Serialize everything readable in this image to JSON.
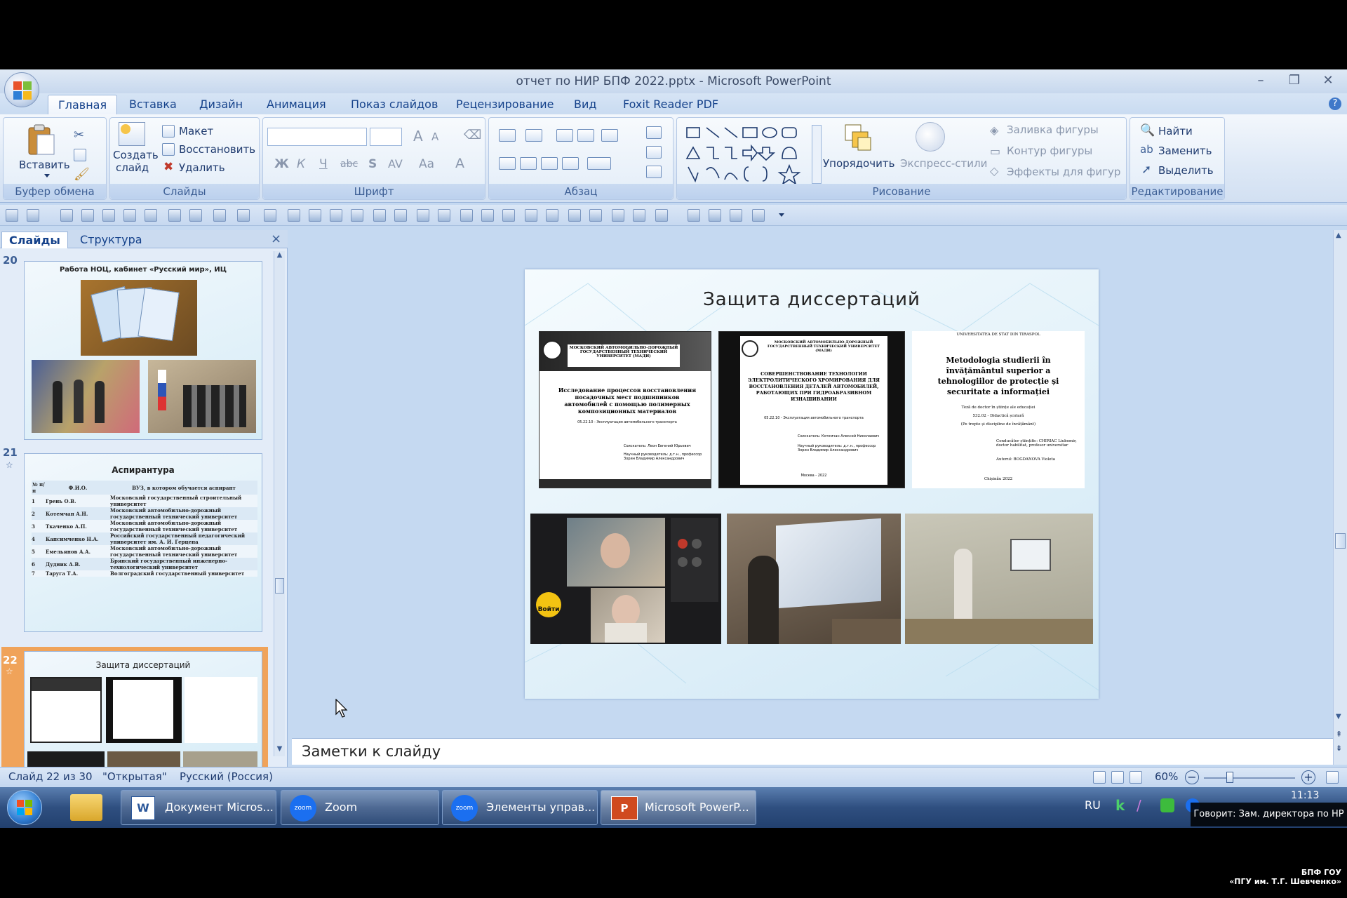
{
  "window": {
    "title": "отчет по НИР БПФ 2022.pptx - Microsoft PowerPoint",
    "minimize": "–",
    "restore": "❐",
    "close": "✕"
  },
  "tabs": [
    "Главная",
    "Вставка",
    "Дизайн",
    "Анимация",
    "Показ слайдов",
    "Рецензирование",
    "Вид",
    "Foxit Reader PDF"
  ],
  "ribbon": {
    "clipboard": {
      "label": "Буфер обмена",
      "paste": "Вставить"
    },
    "slides": {
      "label": "Слайды",
      "create_line1": "Создать",
      "create_line2": "слайд",
      "layout": "Макет",
      "reset": "Восстановить",
      "delete": "Удалить"
    },
    "font": {
      "label": "Шрифт",
      "bold": "Ж",
      "italic": "К",
      "underline": "Ч",
      "strike": "abc",
      "shadow": "S",
      "spacing": "AV",
      "case": "Aa",
      "grow": "A",
      "shrink": "A",
      "color": "A"
    },
    "paragraph": {
      "label": "Абзац"
    },
    "drawing": {
      "label": "Рисование",
      "arrange": "Упорядочить",
      "quick_styles": "Экспресс-стили",
      "fill": "Заливка фигуры",
      "outline": "Контур фигуры",
      "effects": "Эффекты для фигур"
    },
    "editing": {
      "label": "Редактирование",
      "find": "Найти",
      "replace": "Заменить",
      "select": "Выделить"
    }
  },
  "panel": {
    "tab_slides": "Слайды",
    "tab_outline": "Структура",
    "close": "×",
    "slides": [
      {
        "num": "20",
        "title": "Работа НОЦ, кабинет «Русский мир», ИЦ"
      },
      {
        "num": "21",
        "title": "Аспирантура",
        "table_header": [
          "№ п/п",
          "Ф.И.О.",
          "ВУЗ, в котором обучается аспирант"
        ],
        "rows": [
          [
            "1",
            "Грень О.В.",
            "Московский государственный строительный университет"
          ],
          [
            "2",
            "Котемчан А.Н.",
            "Московский автомобильно-дорожный государственный технический университет"
          ],
          [
            "3",
            "Ткаченко А.П.",
            "Московский автомобильно-дорожный государственный технический университет"
          ],
          [
            "4",
            "Капсимченко Н.А.",
            "Российский государственный педагогический университет им. А. И. Герцена"
          ],
          [
            "5",
            "Емельянов А.А.",
            "Московский автомобильно-дорожный государственный технический университет"
          ],
          [
            "6",
            "Дудник А.В.",
            "Брянский государственный инженерно-технологический университет"
          ],
          [
            "7",
            "Таруга Т.А.",
            "Волгоградский государственный университет"
          ]
        ]
      },
      {
        "num": "22",
        "title": "Защита диссертаций"
      }
    ]
  },
  "slide": {
    "title": "Защита диссертаций",
    "doc1": {
      "header": "МОСКОВСКИЙ АВТОМОБИЛЬНО-ДОРОЖНЫЙ ГОСУДАРСТВЕННЫЙ ТЕХНИЧЕСКИЙ УНИВЕРСИТЕТ (МАДИ)",
      "title": "Исследование процессов восстановления посадочных мест подшипников автомобилей с помощью полимерных композиционных материалов",
      "code": "05.22.10 - Эксплуатация автомобильного транспорта",
      "author": "Соискатель: Леон Евгений Юрьевич",
      "advisor": "Научный руководитель: д.т.н., профессор Зорин Владимир Александрович"
    },
    "doc2": {
      "header": "МОСКОВСКИЙ АВТОМОБИЛЬНО-ДОРОЖНЫЙ ГОСУДАРСТВЕННЫЙ ТЕХНИЧЕСКИЙ УНИВЕРСИТЕТ (МАДИ)",
      "title": "СОВЕРШЕНСТВОВАНИЕ ТЕХНОЛОГИИ ЭЛЕКТРОЛИТИЧЕСКОГО ХРОМИРОВАНИЯ ДЛЯ ВОССТАНОВЛЕНИЯ ДЕТАЛЕЙ АВТОМОБИЛЕЙ, РАБОТАЮЩИХ ПРИ ГИДРОАБРАЗИВНОМ ИЗНАШИВАНИИ",
      "code": "05.22.10 - Эксплуатация автомобильного транспорта",
      "author": "Соискатель: Котемчан Алексей Николаевич",
      "advisor": "Научный руководитель: д.т.н., профессор Зорин Владимир Александрович",
      "place": "Москва - 2022"
    },
    "doc3": {
      "header": "UNIVERSITATEA DE STAT DIN TIRASPOL",
      "title": "Metodologia studierii în învățământul superior a tehnologiilor de protecție și securitate a informației",
      "subtitle": "Teză de doctor în științe ale educației",
      "code": "532.02 - Didactică școlară",
      "sub2": "(Pe trepte și discipline de învățământ)",
      "advisor": "Conducător științific: CHIRIAC Liubomir, doctor habilitat, profesor universitar",
      "author": "Autorul: BOGDANOVA Violeta",
      "place": "Chișinău 2022"
    },
    "zoom_join": "Войти"
  },
  "notes_placeholder": "Заметки к слайду",
  "status": {
    "slide": "Слайд 22 из 30",
    "theme": "\"Открытая\"",
    "lang": "Русский (Россия)",
    "zoom": "60%"
  },
  "taskbar": {
    "items": [
      "Документ Micros...",
      "Zoom",
      "Элементы управ...",
      "Microsoft PowerP..."
    ],
    "lang": "RU",
    "time": "11:13"
  },
  "overlay": {
    "speaker": "Говорит: Зам. директора по НР",
    "org_line1": "БПФ ГОУ",
    "org_line2": "«ПГУ им. Т.Г. Шевченко»"
  }
}
